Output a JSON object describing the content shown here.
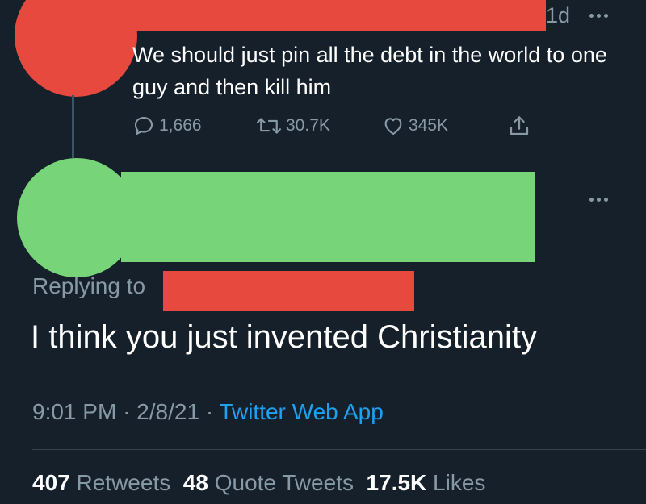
{
  "tweet1": {
    "time_ago": "1d",
    "text": "We should just pin all the debt in the world to one guy and then kill him",
    "replies": "1,666",
    "retweets": "30.7K",
    "likes": "345K",
    "colors": {
      "redaction": "#e8493f",
      "thread_line": "#3d5466"
    }
  },
  "tweet2": {
    "replying_label": "Replying to",
    "text": "I think you just invented Christianity",
    "time": "9:01 PM",
    "date": "2/8/21",
    "source": "Twitter Web App",
    "retweet_count": "407",
    "retweet_label": "Retweets",
    "quote_count": "48",
    "quote_label": "Quote Tweets",
    "like_count": "17.5K",
    "like_label": "Likes",
    "colors": {
      "redaction_avatar_name": "#78d478",
      "redaction_handle": "#e8493f",
      "link": "#1da1f2"
    }
  },
  "icons": [
    "reply-icon",
    "retweet-icon",
    "like-icon",
    "share-icon",
    "more-icon"
  ],
  "theme": {
    "background": "#15202b",
    "secondary_text": "#8899a6",
    "divider": "#38444d"
  }
}
